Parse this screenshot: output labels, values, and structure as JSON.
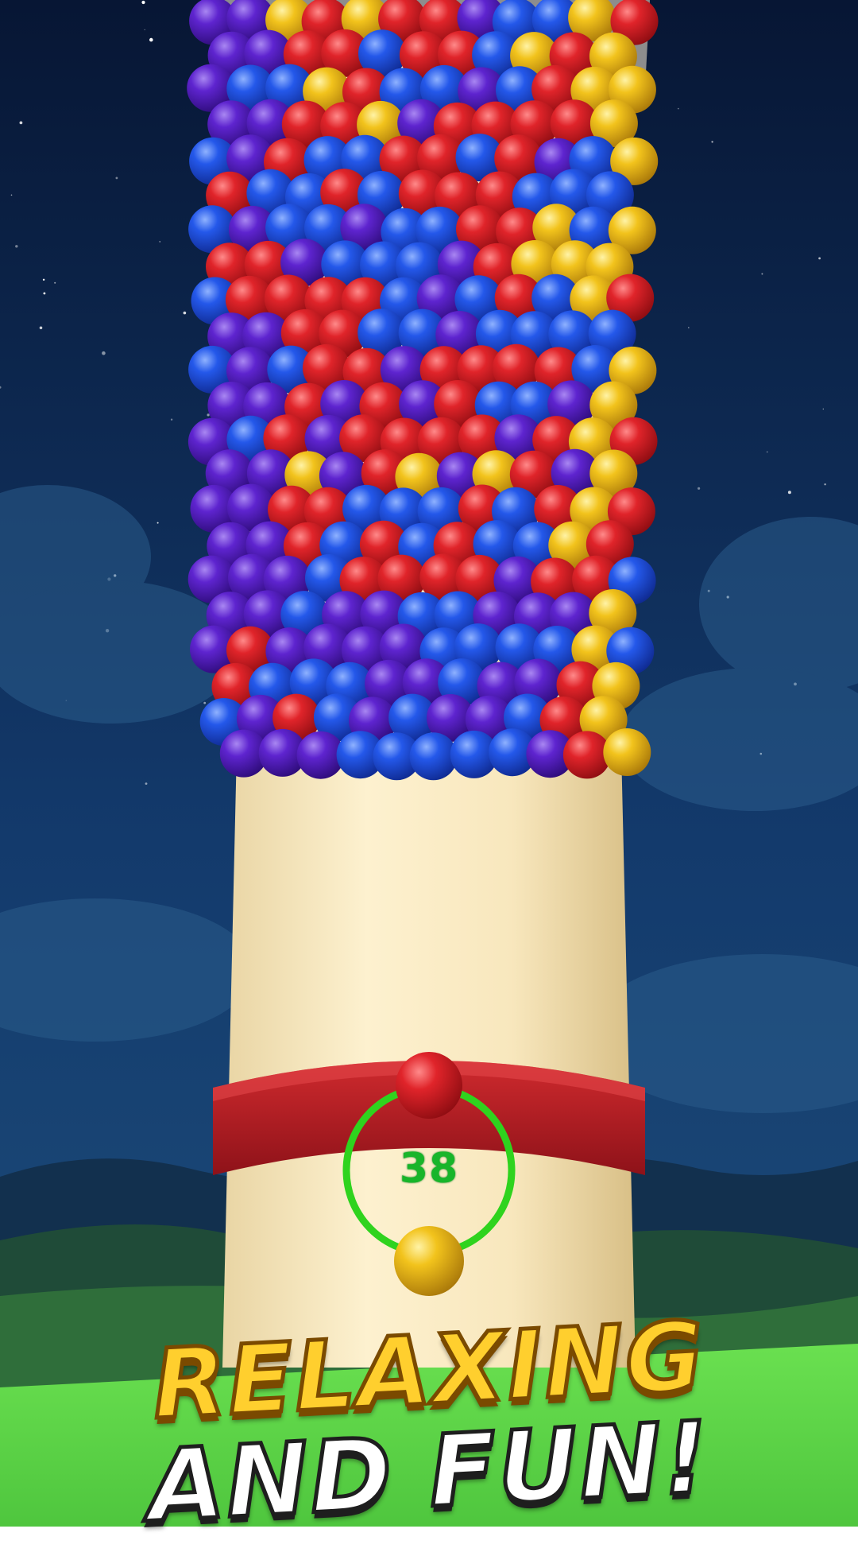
{
  "hud": {
    "shots_left": "38"
  },
  "slogan": {
    "line1": "RELAXING",
    "line2": "AND FUN!"
  },
  "launcher": {
    "current_ball_color": "red",
    "next_ball_color": "yellow"
  },
  "colors": {
    "red": "#d41c1f",
    "blue": "#1f4fe0",
    "purple": "#5a21c8",
    "yellow": "#f0c21a",
    "tower": "#f6e8c2",
    "band": "#b81d24",
    "ring": "#2ecc1f",
    "sky_top": "#0a1a3d",
    "sky_bottom": "#1c4a7a",
    "grass": "#5ed44a"
  }
}
